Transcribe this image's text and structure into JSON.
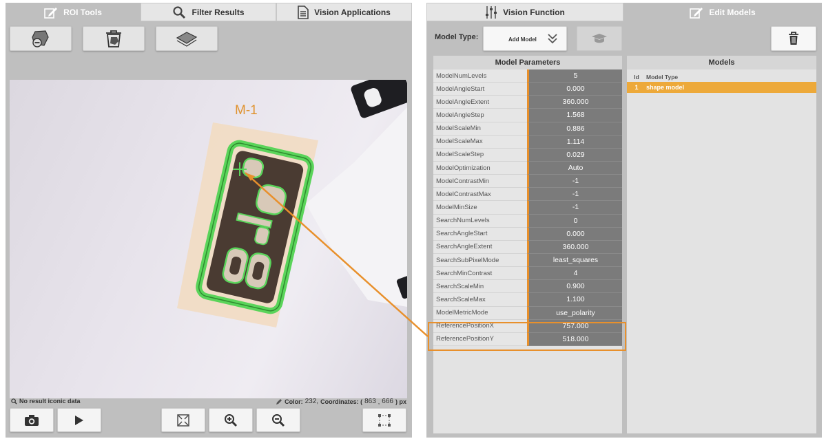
{
  "left_tabs": [
    {
      "label": "ROI Tools",
      "icon": "edit-icon",
      "active": true
    },
    {
      "label": "Filter Results",
      "icon": "search-icon",
      "active": false
    },
    {
      "label": "Vision Applications",
      "icon": "document-icon",
      "active": false
    }
  ],
  "toolbar": {
    "icons": [
      "remove-roi-icon",
      "clear-rois-icon",
      "roi-layers-icon"
    ]
  },
  "viewer": {
    "roi_label": "M-1"
  },
  "status": {
    "message": "No result iconic data",
    "color_label": "Color:",
    "color_value": "232,",
    "coords_label": "Coordinates: (",
    "coord_x": "863",
    "coord_sep": ",",
    "coord_y": "666",
    "coords_unit": ") px"
  },
  "right_tabs": [
    {
      "label": "Vision Function",
      "icon": "sliders-icon",
      "active": false
    },
    {
      "label": "Edit Models",
      "icon": "edit-icon",
      "active": true
    }
  ],
  "model_type": {
    "label": "Model Type:",
    "value": "Add Model"
  },
  "params": {
    "header": "Model Parameters",
    "rows": [
      {
        "name": "ModelNumLevels",
        "value": "5"
      },
      {
        "name": "ModelAngleStart",
        "value": "0.000"
      },
      {
        "name": "ModelAngleExtent",
        "value": "360.000"
      },
      {
        "name": "ModelAngleStep",
        "value": "1.568"
      },
      {
        "name": "ModelScaleMin",
        "value": "0.886"
      },
      {
        "name": "ModelScaleMax",
        "value": "1.114"
      },
      {
        "name": "ModelScaleStep",
        "value": "0.029"
      },
      {
        "name": "ModelOptimization",
        "value": "Auto"
      },
      {
        "name": "ModelContrastMin",
        "value": "-1"
      },
      {
        "name": "ModelContrastMax",
        "value": "-1"
      },
      {
        "name": "ModelMinSize",
        "value": "-1"
      },
      {
        "name": "SearchNumLevels",
        "value": "0"
      },
      {
        "name": "SearchAngleStart",
        "value": "0.000"
      },
      {
        "name": "SearchAngleExtent",
        "value": "360.000"
      },
      {
        "name": "SearchSubPixelMode",
        "value": "least_squares"
      },
      {
        "name": "SearchMinContrast",
        "value": "4"
      },
      {
        "name": "SearchScaleMin",
        "value": "0.900"
      },
      {
        "name": "SearchScaleMax",
        "value": "1.100"
      },
      {
        "name": "ModelMetricMode",
        "value": "use_polarity"
      },
      {
        "name": "ReferencePositionX",
        "value": "757.000"
      },
      {
        "name": "ReferencePositionY",
        "value": "518.000"
      }
    ]
  },
  "models": {
    "header": "Models",
    "col_id": "Id",
    "col_type": "Model Type",
    "rows": [
      {
        "id": "1",
        "type": "shape model"
      }
    ]
  },
  "colors": {
    "accent": "#e8902c",
    "panel": "#bfbfbf",
    "roi_green": "#5ad45a"
  }
}
